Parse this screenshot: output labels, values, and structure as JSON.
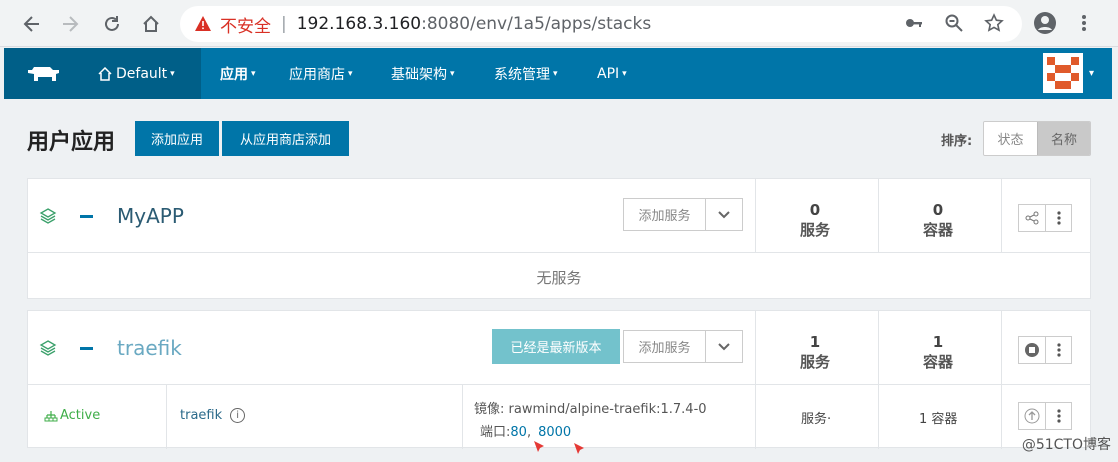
{
  "browser": {
    "insecure_label": "不安全",
    "separator": "|",
    "url_host": "192.168.3.160",
    "url_path": ":8080/env/1a5/apps/stacks"
  },
  "navbar": {
    "environment": "Default",
    "items": [
      {
        "label": "应用",
        "active": true
      },
      {
        "label": "应用商店",
        "active": false
      },
      {
        "label": "基础架构",
        "active": false
      },
      {
        "label": "系统管理",
        "active": false
      },
      {
        "label": "API",
        "active": false
      }
    ]
  },
  "page": {
    "title": "用户应用",
    "add_app_button": "添加应用",
    "add_from_catalog_button": "从应用商店添加",
    "sort_label": "排序:",
    "sort_options": [
      "状态",
      "名称"
    ],
    "sort_selected": "名称"
  },
  "stacks": [
    {
      "name": "MyAPP",
      "add_service_label": "添加服务",
      "services_count": "0",
      "services_label": "服务",
      "containers_count": "0",
      "containers_label": "容器",
      "empty_text": "无服务"
    },
    {
      "name": "traefik",
      "update_label": "已经是最新版本",
      "add_service_label": "添加服务",
      "services_count": "1",
      "services_label": "服务",
      "containers_count": "1",
      "containers_label": "容器",
      "service": {
        "state": "Active",
        "name": "traefik",
        "info_glyph": "i",
        "image_label": "镜像:",
        "image": "rawmind/alpine-traefik:1.7.4-0",
        "ports_label": "端口:",
        "port1": "80",
        "port_sep": ",",
        "port2": "8000",
        "service_col": "服务·",
        "container_col": "1 容器"
      }
    }
  ],
  "watermark": "@51CTO博客",
  "colors": {
    "brand": "#0075a8",
    "brand_dark": "#005f88",
    "active_green": "#3fae49",
    "update_teal": "#73c2cc",
    "warning_red": "#d93025"
  }
}
